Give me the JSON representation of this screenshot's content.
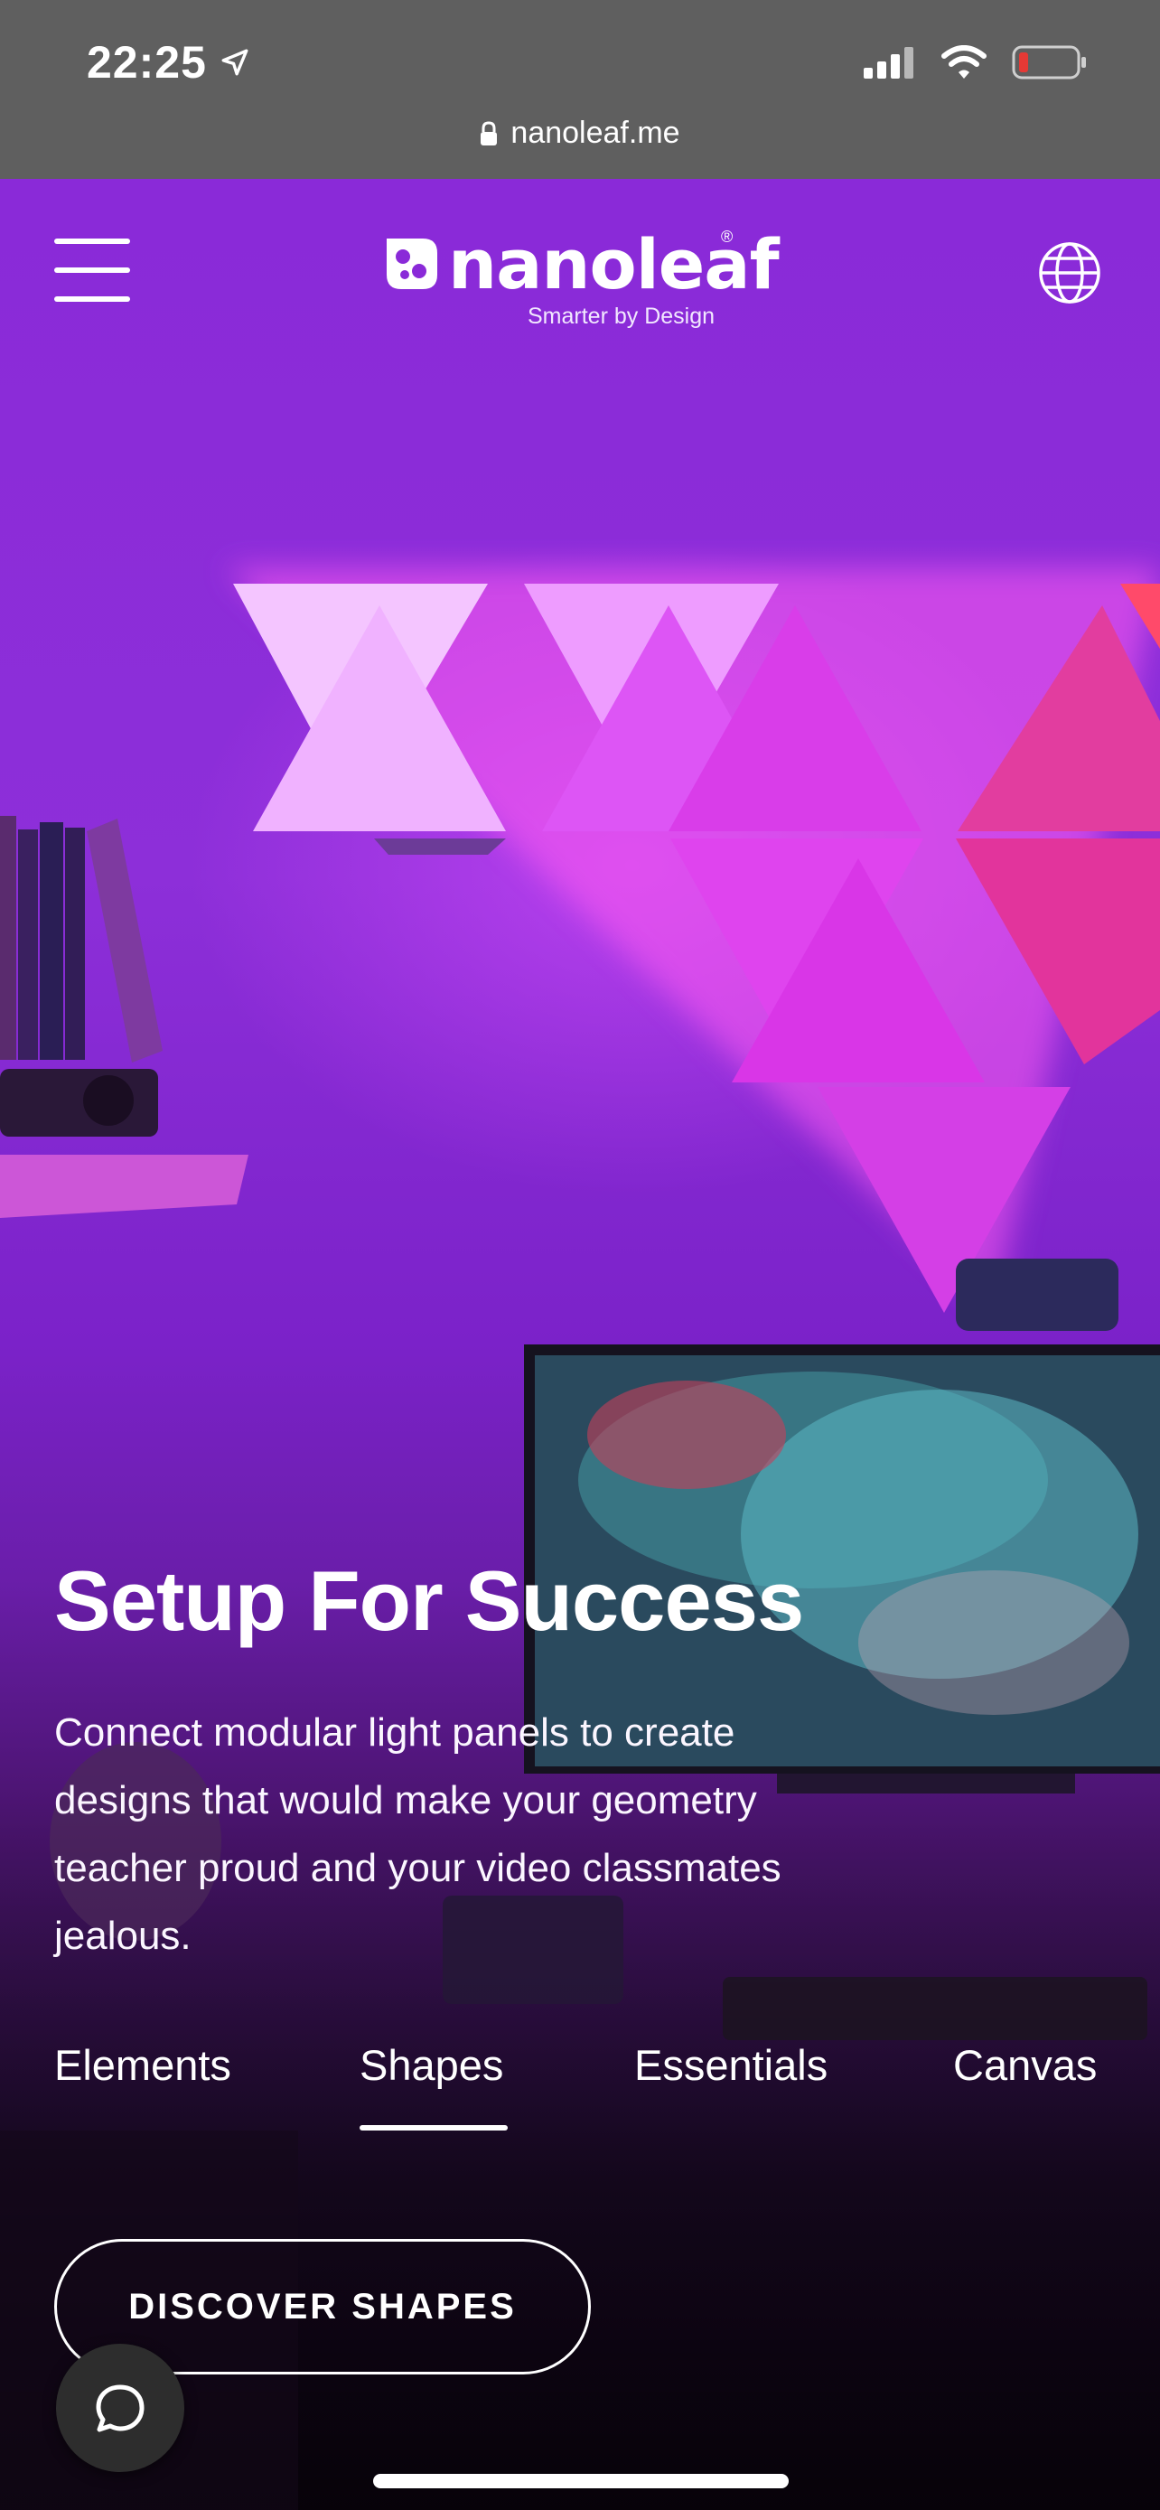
{
  "status_bar": {
    "time": "22:25",
    "location_icon": "location-arrow-icon",
    "signal_icon": "cellular-signal-icon",
    "wifi_icon": "wifi-icon",
    "battery_icon": "battery-low-icon",
    "battery_color": "#e53935"
  },
  "url_bar": {
    "lock_icon": "lock-icon",
    "url": "nanoleaf.me"
  },
  "header": {
    "menu_icon": "hamburger-menu-icon",
    "logo_text": "nanoleaf",
    "logo_registered": "®",
    "tagline": "Smarter by Design",
    "globe_icon": "globe-icon"
  },
  "hero": {
    "headline": "Setup For Success",
    "description": "Connect modular light panels to create designs that would make your geometry teacher proud and your video classmates jealous.",
    "accent_color": "#8a2ad8"
  },
  "tabs": [
    {
      "label": "Elements",
      "active": false
    },
    {
      "label": "Shapes",
      "active": true
    },
    {
      "label": "Essentials",
      "active": false
    },
    {
      "label": "Canvas",
      "active": false
    }
  ],
  "cta": {
    "label": "DISCOVER SHAPES"
  },
  "chat": {
    "icon": "chat-bubble-icon"
  }
}
